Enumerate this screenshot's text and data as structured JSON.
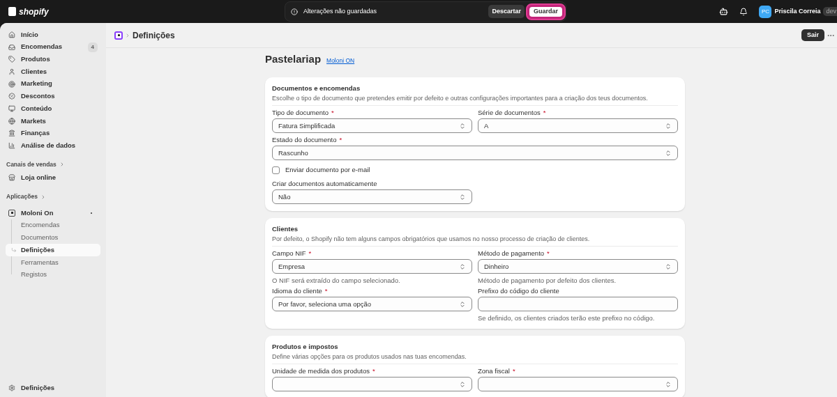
{
  "topbar": {
    "logo": "shopify",
    "message": "Alterações não guardadas",
    "discard": "Descartar",
    "save": "Guardar",
    "user": {
      "initials": "PC",
      "name": "Priscila Correia",
      "badge": "dev"
    }
  },
  "sidebar": {
    "items": [
      {
        "label": "Início"
      },
      {
        "label": "Encomendas",
        "badge": "4"
      },
      {
        "label": "Produtos"
      },
      {
        "label": "Clientes"
      },
      {
        "label": "Marketing"
      },
      {
        "label": "Descontos"
      },
      {
        "label": "Conteúdo"
      },
      {
        "label": "Markets"
      },
      {
        "label": "Finanças"
      },
      {
        "label": "Análise de dados"
      }
    ],
    "channels": {
      "heading": "Canais de vendas",
      "items": [
        {
          "label": "Loja online"
        }
      ]
    },
    "apps": {
      "heading": "Aplicações",
      "app": {
        "label": "Moloni On",
        "children": [
          {
            "label": "Encomendas",
            "selected": false
          },
          {
            "label": "Documentos",
            "selected": false
          },
          {
            "label": "Definições",
            "selected": true
          },
          {
            "label": "Ferramentas",
            "selected": false
          },
          {
            "label": "Registos",
            "selected": false
          }
        ]
      }
    },
    "footer": "Definições"
  },
  "header": {
    "title": "Definições",
    "exit": "Sair"
  },
  "page": {
    "title": "Pastelariap",
    "link": "Moloni ON",
    "cards": [
      {
        "title": "Documentos e encomendas",
        "description": "Escolhe o tipo de documento que pretendes emitir por defeito e outras configurações importantes para a criação dos teus documentos.",
        "fields": [
          {
            "kind": "select",
            "label": "Tipo de documento",
            "required_mark": "*",
            "value": "Fatura Simplificada"
          },
          {
            "kind": "select",
            "label": "Série de documentos",
            "required_mark": "*",
            "value": "A"
          },
          {
            "kind": "wide-select",
            "label": "Estado do documento",
            "required_mark": "*",
            "value": "Rascunho"
          },
          {
            "kind": "checkbox",
            "label": "Enviar documento por e-mail",
            "checked": false
          },
          {
            "kind": "select",
            "label": "Criar documentos automaticamente",
            "value": "Não"
          }
        ]
      },
      {
        "title": "Clientes",
        "description": "Por defeito, o Shopify não tem alguns campos obrigatórios que usamos no nosso processo de criação de clientes.",
        "fields": [
          {
            "kind": "select",
            "label": "Campo NIF",
            "required_mark": "*",
            "value": "Empresa",
            "help": "O NIF será extraído do campo selecionado."
          },
          {
            "kind": "select",
            "label": "Método de pagamento",
            "required_mark": "*",
            "value": "Dinheiro",
            "help": "Método de pagamento por defeito dos clientes."
          },
          {
            "kind": "select",
            "label": "Idioma do cliente",
            "required_mark": "*",
            "value": "Por favor, seleciona uma opção"
          },
          {
            "kind": "text",
            "label": "Prefixo do código do cliente",
            "help": "Se definido, os clientes criados terão este prefixo no código."
          }
        ]
      },
      {
        "title": "Produtos e impostos",
        "description": "Define várias opções para os produtos usados nas tuas encomendas.",
        "fields": [
          {
            "kind": "select",
            "label": "Unidade de medida dos produtos",
            "required_mark": "*"
          },
          {
            "kind": "select",
            "label": "Zona fiscal",
            "required_mark": "*"
          }
        ]
      }
    ]
  }
}
